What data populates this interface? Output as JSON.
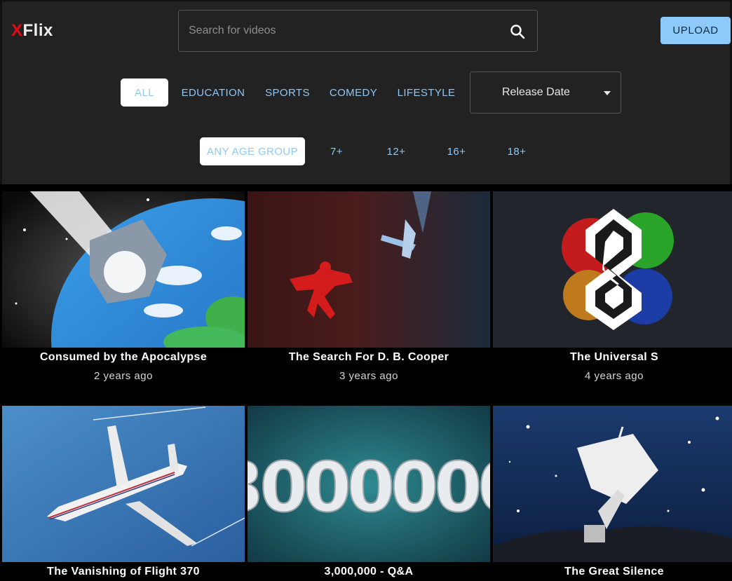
{
  "brand": {
    "logo_x": "X",
    "logo_rest": "Flix"
  },
  "search": {
    "placeholder": "Search for videos"
  },
  "header": {
    "upload_label": "UPLOAD"
  },
  "genres": [
    "ALL",
    "EDUCATION",
    "SPORTS",
    "COMEDY",
    "LIFESTYLE"
  ],
  "sort": {
    "selected": "Release Date"
  },
  "age_groups": [
    "ANY AGE GROUP",
    "7+",
    "12+",
    "16+",
    "18+"
  ],
  "videos": [
    {
      "title": "Consumed by the Apocalypse",
      "released": "2 years ago"
    },
    {
      "title": "The Search For D. B. Cooper",
      "released": "3 years ago"
    },
    {
      "title": "The Universal S",
      "released": "4 years ago"
    },
    {
      "title": "The Vanishing of Flight 370",
      "released": ""
    },
    {
      "title": "3,000,000 - Q&A",
      "released": ""
    },
    {
      "title": "The Great Silence",
      "released": ""
    }
  ],
  "thumb_text": {
    "big_number": "3000000"
  },
  "colors": {
    "accent_blue": "#8ecaf9",
    "logo_red": "#e50914",
    "header_bg": "#222222"
  }
}
